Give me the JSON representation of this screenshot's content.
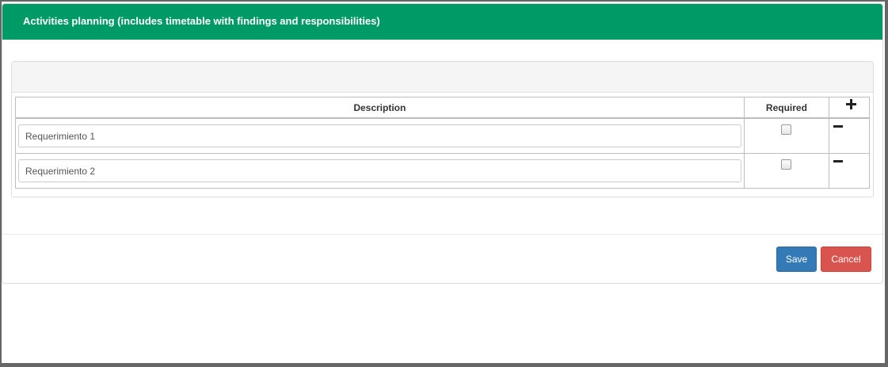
{
  "modal": {
    "title": "Activities planning (includes timetable with findings and responsibilities)"
  },
  "table": {
    "headers": {
      "description": "Description",
      "required": "Required"
    },
    "rows": [
      {
        "description": "Requerimiento 1",
        "required": false
      },
      {
        "description": "Requerimiento 2",
        "required": false
      }
    ]
  },
  "footer": {
    "save_label": "Save",
    "cancel_label": "Cancel"
  },
  "colors": {
    "header_green": "#009a66",
    "save_blue": "#337ab7",
    "cancel_red": "#d9534f"
  },
  "icons": {
    "add_row": "plus-icon",
    "remove_row": "minus-icon"
  }
}
